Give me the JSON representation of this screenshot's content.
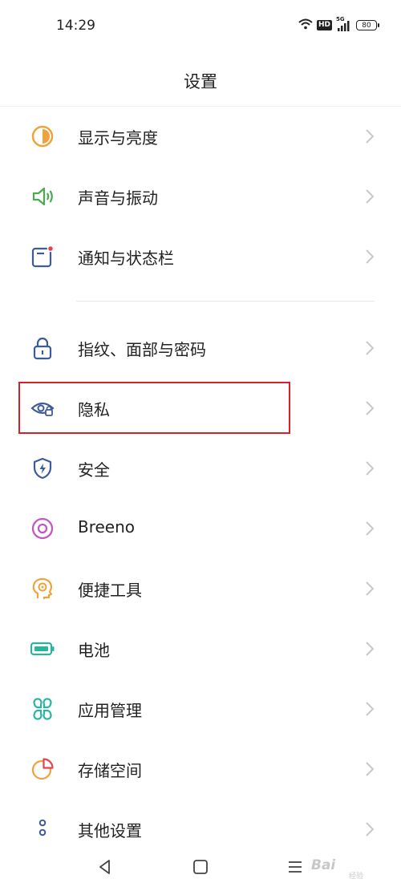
{
  "status_bar": {
    "time": "14:29",
    "hd": "HD",
    "network": "5G",
    "battery": "80"
  },
  "header": {
    "title": "设置"
  },
  "settings": {
    "items": [
      {
        "label": "显示与亮度",
        "icon": "display-brightness-icon",
        "color": "#f0a33c"
      },
      {
        "label": "声音与振动",
        "icon": "speaker-icon",
        "color": "#4aaa52"
      },
      {
        "label": "通知与状态栏",
        "icon": "notification-icon",
        "color": "#3d5a99"
      },
      {
        "label": "指纹、面部与密码",
        "icon": "lock-icon",
        "color": "#3d5a99"
      },
      {
        "label": "隐私",
        "icon": "privacy-eye-icon",
        "color": "#3d5a99"
      },
      {
        "label": "安全",
        "icon": "shield-icon",
        "color": "#3d5a99"
      },
      {
        "label": "Breeno",
        "icon": "breeno-icon",
        "color": "#c05ac0"
      },
      {
        "label": "便捷工具",
        "icon": "head-gear-icon",
        "color": "#f0a33c"
      },
      {
        "label": "电池",
        "icon": "battery-icon",
        "color": "#2bb3a0"
      },
      {
        "label": "应用管理",
        "icon": "apps-icon",
        "color": "#2bb3a0"
      },
      {
        "label": "存储空间",
        "icon": "storage-pie-icon",
        "color": "#f0a33c"
      },
      {
        "label": "其他设置",
        "icon": "more-dots-icon",
        "color": "#3d5a99"
      }
    ]
  },
  "highlighted_item": "隐私",
  "watermark": {
    "text": "Bai",
    "sub": "经验"
  }
}
